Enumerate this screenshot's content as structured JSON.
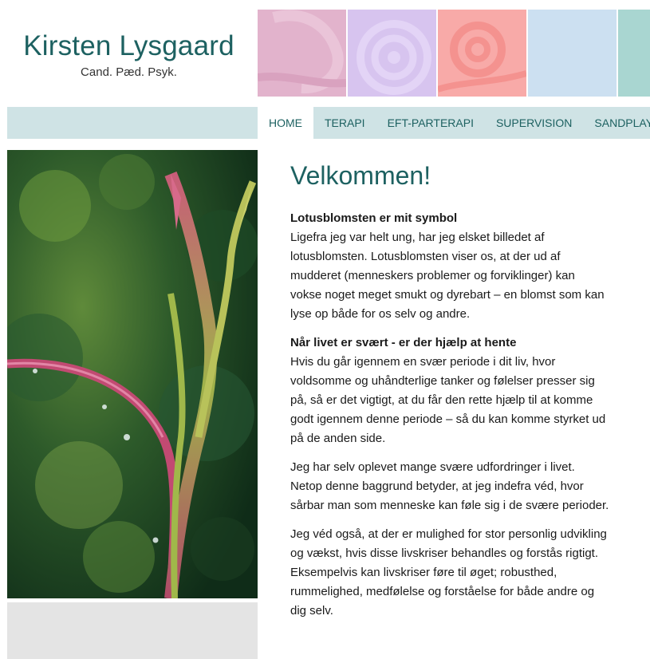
{
  "header": {
    "name": "Kirsten Lysgaard",
    "subtitle": "Cand. Pæd. Psyk."
  },
  "nav": {
    "items": [
      "HOME",
      "TERAPI",
      "EFT-PARTERAPI",
      "SUPERVISION",
      "SANDPLAY"
    ],
    "active": "HOME"
  },
  "colors": {
    "brand": "#1d6161",
    "nav_bg": "#cfe3e5",
    "tile_pink": "#e2b3cc",
    "tile_lilac": "#d7c4ef",
    "tile_salmon": "#f8aaa8",
    "tile_blue": "#cce0f1",
    "tile_teal": "#a9d6d1"
  },
  "main": {
    "heading": "Velkommen!",
    "sections": [
      {
        "title": "Lotusblomsten er mit symbol",
        "text": "Ligefra jeg var helt ung, har jeg elsket billedet af lotusblomsten. Lotusblomsten viser os, at der ud af mudderet (menneskers problemer og forviklinger) kan vokse noget meget smukt og dyrebart – en blomst som kan lyse op både for os selv og andre."
      },
      {
        "title": "Når livet er svært - er der hjælp at hente",
        "text": "Hvis du går igennem en svær periode i dit liv, hvor voldsomme og uhåndterlige tanker og følelser presser sig på, så er det vigtigt, at du får den rette hjælp til at komme godt igennem denne periode – så du kan komme styrket ud på de anden side."
      },
      {
        "title": "",
        "text": "Jeg har selv oplevet mange svære udfordringer i livet. Netop denne baggrund betyder, at jeg indefra véd, hvor sårbar man som menneske kan føle sig i de svære perioder."
      },
      {
        "title": "",
        "text": "Jeg véd også, at der er mulighed for stor personlig udvikling og vækst, hvis disse livskriser behandles og forstås rigtigt. Eksempelvis kan livskriser føre til øget; robusthed, rummelighed, medfølelse og forståelse for både andre og dig selv."
      }
    ]
  }
}
